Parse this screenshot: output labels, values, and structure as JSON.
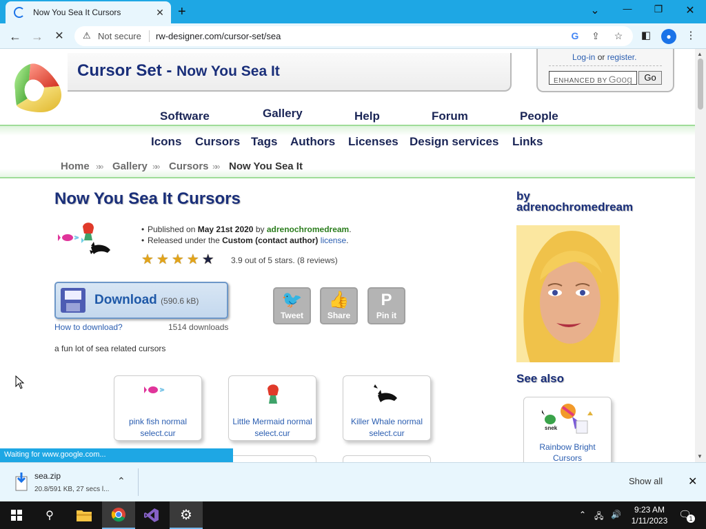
{
  "browser": {
    "tab_title": "Now You Sea It Cursors",
    "tab_close": "✕",
    "new_tab": "+",
    "security_label": "Not secure",
    "url": "rw-designer.com/cursor-set/sea",
    "window_controls": {
      "chevron": "⌄",
      "minimize": "—",
      "restore": "❐",
      "close": "✕"
    }
  },
  "site": {
    "title": "Cursor Set -",
    "subtitle": "Now You Sea It",
    "login": "Log-in",
    "or": "or",
    "register": "register.",
    "search_placeholder": "ENHANCED BY",
    "search_brand": "Goog",
    "search_go": "Go"
  },
  "topnav": [
    "Software",
    "Gallery",
    "Help",
    "Forum",
    "People"
  ],
  "subnav": [
    "Icons",
    "Cursors",
    "Tags",
    "Authors",
    "Licenses",
    "Design services",
    "Links"
  ],
  "breadcrumb": [
    "Home",
    "Gallery",
    "Cursors",
    "Now You Sea It"
  ],
  "main": {
    "heading": "Now You Sea It Cursors",
    "published_prefix": "Published on",
    "published_date": "May 21st 2020",
    "published_by": "by",
    "author": "adrenochromedream",
    "period": ".",
    "released_prefix": "Released under the",
    "license_name": "Custom (contact author)",
    "license_link": "license",
    "rating_text": "3.9 out of 5 stars. (8 reviews)",
    "rating_value": 3.9,
    "rating_max": 5,
    "download_label": "Download",
    "download_size": "(590.6 kB)",
    "how_to": "How to download?",
    "download_count": "1514 downloads",
    "description": "a fun lot of sea related cursors",
    "share": [
      {
        "label": "Tweet",
        "icon": "twitter-icon"
      },
      {
        "label": "Share",
        "icon": "thumbs-up-icon"
      },
      {
        "label": "Pin it",
        "icon": "pinterest-icon"
      }
    ],
    "cursors": [
      {
        "name": "pink fish normal",
        "file": "select.cur"
      },
      {
        "name": "Little Mermaid normal",
        "file": "select.cur"
      },
      {
        "name": "Killer Whale normal",
        "file": "select.cur"
      }
    ]
  },
  "sidebar": {
    "by": "by",
    "author": "adrenochromedream",
    "see_also": "See also",
    "related": {
      "name": "Rainbow Bright",
      "name2": "Cursors",
      "snek": "snek"
    }
  },
  "status_text": "Waiting for www.google.com...",
  "download_shelf": {
    "file_name": "sea.zip",
    "progress": "20.8/591 KB, 27 secs l...",
    "show_all": "Show all"
  },
  "taskbar": {
    "time": "9:23 AM",
    "date": "1/11/2023",
    "notification_count": "1"
  },
  "colors": {
    "accent": "#1ea7e4",
    "heading": "#1a2f7a",
    "link": "#2a5db0",
    "nav_band": "#9fdc98"
  }
}
